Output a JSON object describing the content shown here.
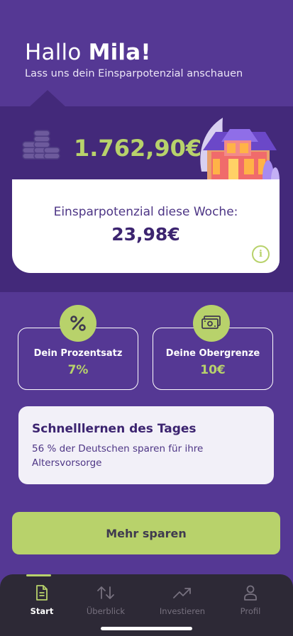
{
  "header": {
    "greeting_prefix": "Hallo",
    "user_name": "Mila!",
    "subtitle": "Lass uns dein Einsparpotenzial anschauen"
  },
  "balance": {
    "amount": "1.762,90€"
  },
  "weekly": {
    "label": "Einsparpotenzial diese Woche:",
    "value": "23,98€",
    "info_icon": "i"
  },
  "stats": [
    {
      "title": "Dein Prozentsatz",
      "value": "7%",
      "icon": "percent-icon"
    },
    {
      "title": "Deine Obergrenze",
      "value": "10€",
      "icon": "banknote-icon"
    }
  ],
  "learn": {
    "title": "Schnelllernen des Tages",
    "text": "56 % der Deutschen sparen für ihre Altersvorsorge"
  },
  "cta": {
    "label": "Mehr sparen"
  },
  "tabbar": {
    "items": [
      {
        "label": "Start",
        "icon": "document-icon",
        "active": true
      },
      {
        "label": "Überblick",
        "icon": "arrows-updown-icon",
        "active": false
      },
      {
        "label": "Investieren",
        "icon": "trending-up-icon",
        "active": false
      },
      {
        "label": "Profil",
        "icon": "person-icon",
        "active": false
      }
    ]
  },
  "colors": {
    "background": "#553894",
    "hero": "#43297a",
    "accent": "#b8d26b",
    "card": "#ffffff",
    "learn_card": "#f2f0f8",
    "tabbar": "#2d2936"
  }
}
